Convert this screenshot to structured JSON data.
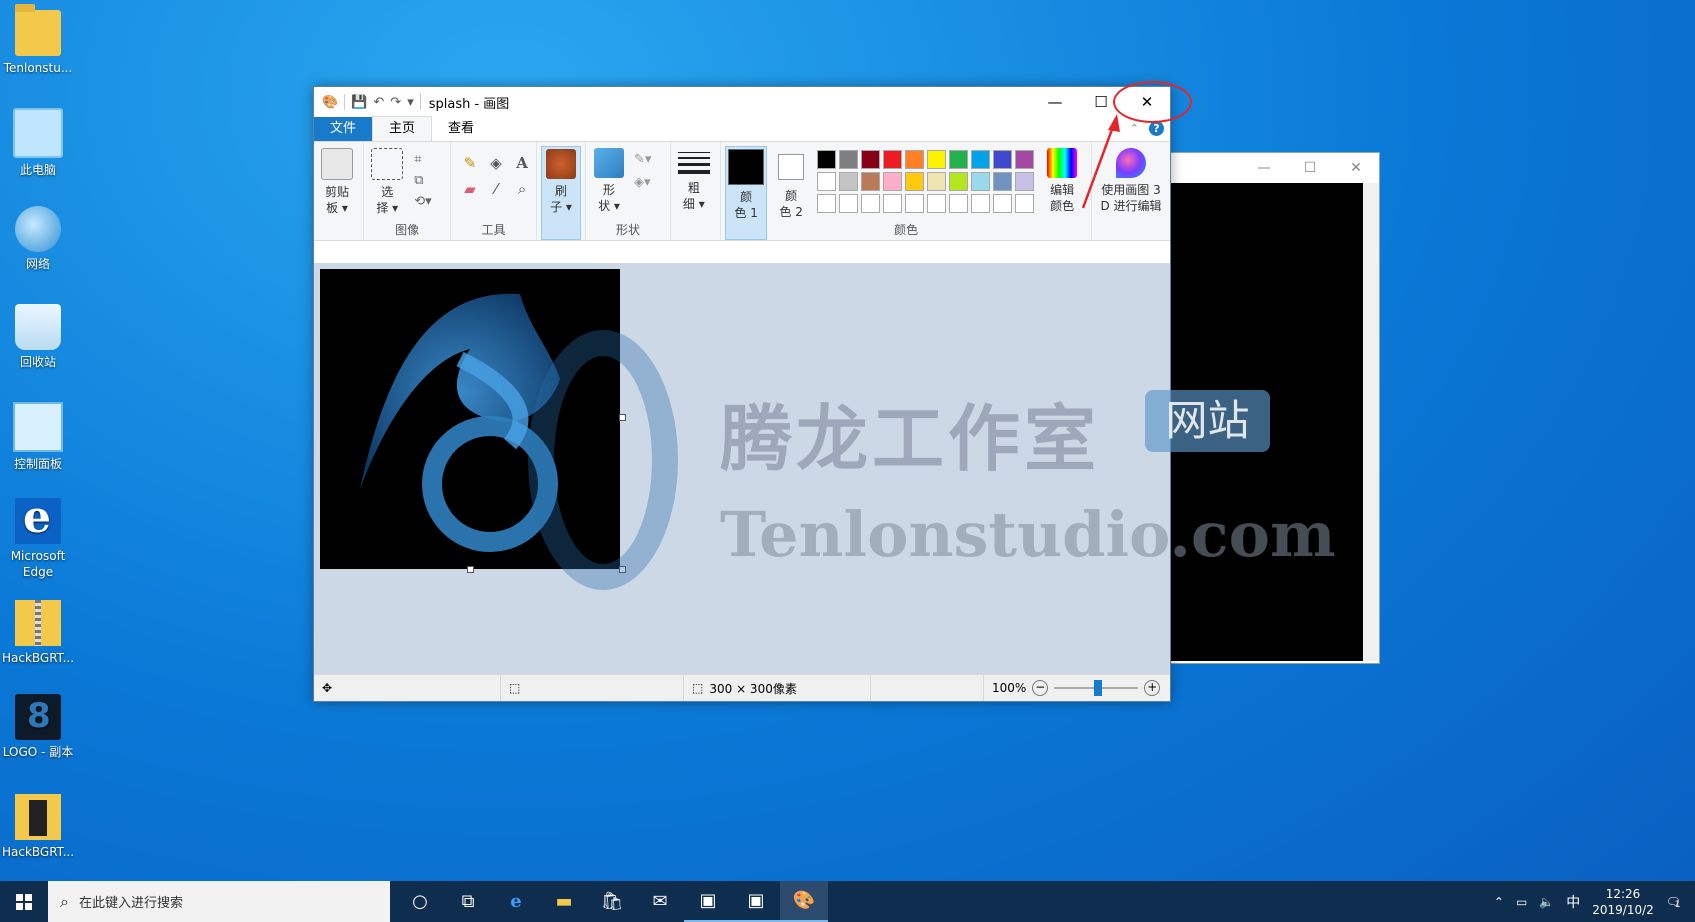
{
  "desktop": {
    "icons": [
      {
        "label": "Tenlonstu..."
      },
      {
        "label": "此电脑"
      },
      {
        "label": "网络"
      },
      {
        "label": "回收站"
      },
      {
        "label": "控制面板"
      },
      {
        "label": "Microsoft Edge"
      },
      {
        "label": "HackBGRT..."
      },
      {
        "label": "LOGO - 副本"
      },
      {
        "label": "HackBGRT..."
      }
    ]
  },
  "paint": {
    "title": "splash - 画图",
    "tabs": {
      "file": "文件",
      "home": "主页",
      "view": "查看"
    },
    "ribbon": {
      "clipboard": {
        "btn1": "剪贴",
        "btn2": "板"
      },
      "image": {
        "btn1": "选",
        "btn2": "择",
        "label": "图像"
      },
      "tools": {
        "label": "工具"
      },
      "brush": {
        "btn1": "刷",
        "btn2": "子"
      },
      "shapes": {
        "btn1": "形",
        "btn2": "状",
        "label": "形状"
      },
      "size": {
        "btn1": "粗",
        "btn2": "细"
      },
      "color1": {
        "btn1": "颜",
        "btn2": "色 1"
      },
      "color2": {
        "btn1": "颜",
        "btn2": "色 2"
      },
      "colors_label": "颜色",
      "edit_colors": {
        "btn1": "编辑",
        "btn2": "颜色"
      },
      "paint3d": {
        "btn1": "使用画图 3",
        "btn2": "D 进行编辑"
      }
    },
    "palette": [
      "#000000",
      "#7f7f7f",
      "#880015",
      "#ed1c24",
      "#ff7f27",
      "#fff200",
      "#22b14c",
      "#00a2e8",
      "#3f48cc",
      "#a349a4",
      "#ffffff",
      "#c3c3c3",
      "#b97a57",
      "#ffaec9",
      "#ffc90e",
      "#efe4b0",
      "#b5e61d",
      "#99d9ea",
      "#7092be",
      "#c8bfe7",
      "#ffffff",
      "#ffffff",
      "#ffffff",
      "#ffffff",
      "#ffffff",
      "#ffffff",
      "#ffffff",
      "#ffffff",
      "#ffffff",
      "#ffffff"
    ],
    "status": {
      "dimensions": "300 × 300像素",
      "zoom": "100%"
    }
  },
  "watermark": {
    "cn": "腾龙工作室",
    "badge": "网站",
    "url": "Tenlonstudio.com"
  },
  "taskbar": {
    "search_placeholder": "在此键入进行搜索",
    "ime": "中",
    "time": "12:26",
    "date": "2019/10/2",
    "notifications": "1"
  },
  "colors": {
    "accent": "#1979ca",
    "annotation": "#e3262c"
  }
}
